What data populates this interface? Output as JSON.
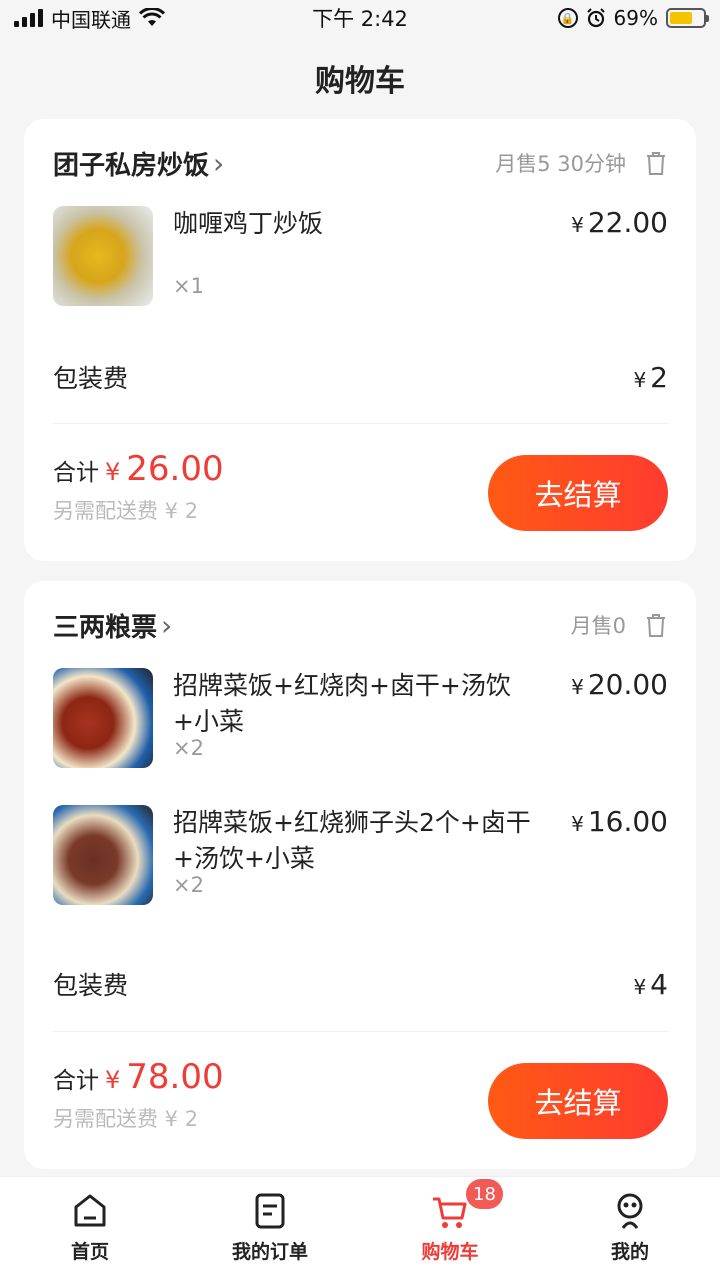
{
  "status_bar": {
    "carrier": "中国联通",
    "time": "下午 2:42",
    "battery_percent": "69%",
    "battery_level": 0.69
  },
  "header": {
    "title": "购物车"
  },
  "carts": [
    {
      "shop_name": "团子私房炒饭",
      "meta": "月售5 30分钟",
      "items": [
        {
          "name": "咖喱鸡丁炒饭",
          "qty": "×1",
          "price": "22.00",
          "currency": "¥"
        }
      ],
      "packaging_label": "包装费",
      "packaging_fee": "2",
      "total_label": "合计",
      "total_currency": "¥",
      "total": "26.00",
      "delivery_note": "另需配送费 ¥ 2",
      "checkout_label": "去结算"
    },
    {
      "shop_name": "三两粮票",
      "meta": "月售0",
      "items": [
        {
          "name": "招牌菜饭+红烧肉+卤干+汤饮+小菜",
          "qty": "×2",
          "price": "20.00",
          "currency": "¥"
        },
        {
          "name": "招牌菜饭+红烧狮子头2个+卤干+汤饮+小菜",
          "qty": "×2",
          "price": "16.00",
          "currency": "¥"
        }
      ],
      "packaging_label": "包装费",
      "packaging_fee": "4",
      "total_label": "合计",
      "total_currency": "¥",
      "total": "78.00",
      "delivery_note": "另需配送费 ¥ 2",
      "checkout_label": "去结算"
    }
  ],
  "tabbar": {
    "tabs": [
      {
        "label": "首页",
        "icon": "home-icon"
      },
      {
        "label": "我的订单",
        "icon": "orders-icon"
      },
      {
        "label": "购物车",
        "icon": "cart-icon",
        "active": true,
        "badge": "18"
      },
      {
        "label": "我的",
        "icon": "profile-icon"
      }
    ]
  },
  "colors": {
    "accent": "#f03c36",
    "button_start": "#ff5a14",
    "button_end": "#ff3b30"
  }
}
